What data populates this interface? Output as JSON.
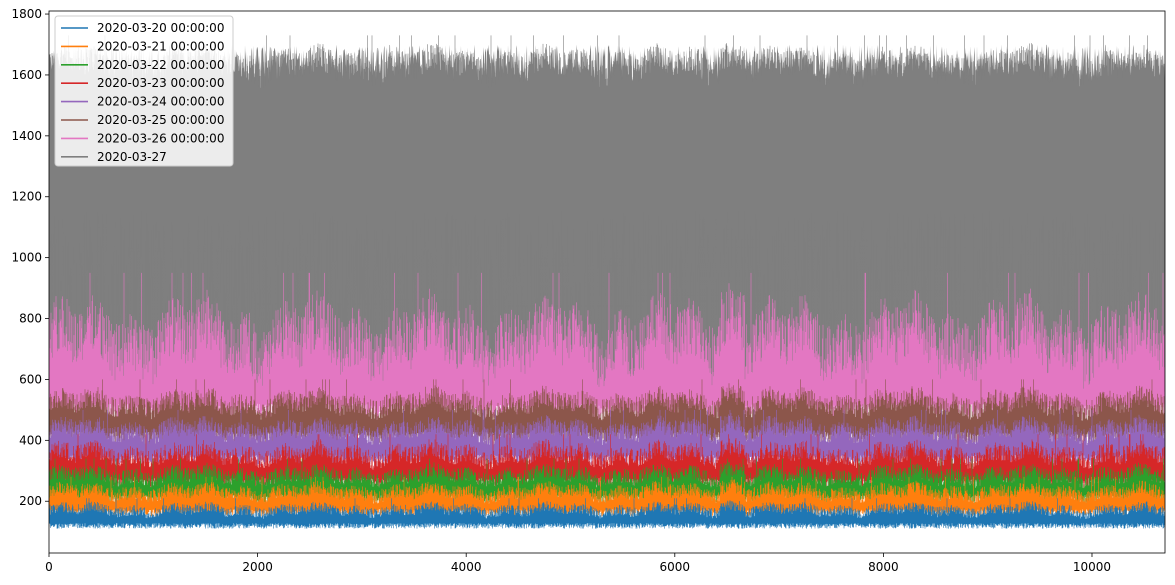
{
  "chart_data": {
    "type": "line",
    "title": "",
    "xlabel": "",
    "ylabel": "",
    "xlim": [
      0,
      10700
    ],
    "ylim": [
      30,
      1810
    ],
    "xticks": [
      0,
      2000,
      4000,
      6000,
      8000,
      10000
    ],
    "yticks": [
      200,
      400,
      600,
      800,
      1000,
      1200,
      1400,
      1600,
      1800
    ],
    "grid": false,
    "legend_position": "top-left",
    "n_points": 10700,
    "series": [
      {
        "name": "2020-03-20 00:00:00",
        "color": "#1f77b4",
        "baseline": 140,
        "range": [
          110,
          210
        ]
      },
      {
        "name": "2020-03-21 00:00:00",
        "color": "#ff7f0e",
        "baseline": 190,
        "range": [
          150,
          280
        ]
      },
      {
        "name": "2020-03-22 00:00:00",
        "color": "#2ca02c",
        "baseline": 240,
        "range": [
          190,
          340
        ]
      },
      {
        "name": "2020-03-23 00:00:00",
        "color": "#d62728",
        "baseline": 300,
        "range": [
          240,
          420
        ]
      },
      {
        "name": "2020-03-24 00:00:00",
        "color": "#9467bd",
        "baseline": 380,
        "range": [
          310,
          500
        ]
      },
      {
        "name": "2020-03-25 00:00:00",
        "color": "#8c564b",
        "baseline": 460,
        "range": [
          380,
          600
        ]
      },
      {
        "name": "2020-03-26 00:00:00",
        "color": "#e377c2",
        "baseline": 560,
        "range": [
          460,
          950
        ]
      },
      {
        "name": "2020-03-27",
        "color": "#7f7f7f",
        "baseline": 1550,
        "range": [
          560,
          1730
        ]
      }
    ]
  }
}
